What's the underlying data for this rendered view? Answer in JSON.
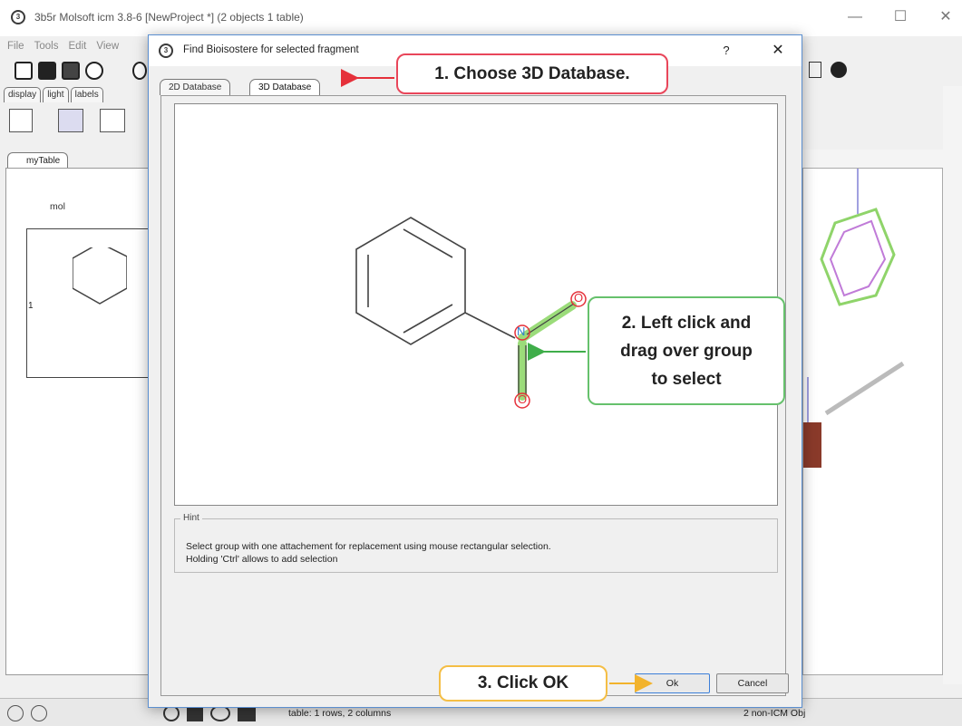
{
  "window": {
    "title": "3b5r Molsoft icm 3.8-6  [NewProject *] (2 objects 1 table)",
    "controls": [
      "—",
      "☐",
      "✕"
    ]
  },
  "menu": [
    "File",
    "Tools",
    "Edit",
    "View"
  ],
  "left_tabs": [
    "display",
    "light",
    "labels"
  ],
  "table": {
    "tab_label": "myTable",
    "column_header": "mol",
    "row_number": "1"
  },
  "dialog": {
    "title": "Find Bioisostere for selected fragment",
    "help": "?",
    "close": "✕",
    "tabs": [
      "2D Database",
      "3D Database"
    ],
    "atoms": {
      "nitrogen": "N",
      "oxygen_top": "O",
      "oxygen_bottom": "O"
    },
    "hint_legend": "Hint",
    "hint_line1": "Select group with one attachement for replacement using mouse rectangular selection.",
    "hint_line2": "Holding 'Ctrl' allows to add selection",
    "ok_label": "Ok",
    "cancel_label": "Cancel"
  },
  "callouts": {
    "step1": "1. Choose 3D Database.",
    "step2_lines": [
      "2. Left click and",
      "drag over group",
      "to select"
    ],
    "step3": "3. Click OK"
  },
  "status": {
    "left": "table: 1 rows, 2 columns",
    "right": "2 non-ICM Obj"
  },
  "colors": {
    "callout1_border": "#e9465a",
    "callout2_border": "#66c16c",
    "callout3_border": "#f4be45",
    "selection_green": "#9bdc7a",
    "nitrogen_blue": "#2f7fd0",
    "oxygen_red": "#e5303a"
  }
}
